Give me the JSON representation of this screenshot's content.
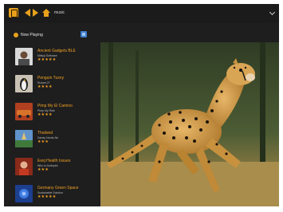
{
  "header": {
    "title": "music"
  },
  "sidebar": {
    "now_playing_label": "Now Playing",
    "tracks": [
      {
        "title": "Ancient Gadgets BLE",
        "subtitle": "Mitsuji Software",
        "stars": "★★★★★"
      },
      {
        "title": "Penguin Tuxny",
        "subtitle": "Russel-27",
        "stars": "★★★★"
      },
      {
        "title": "Pimp My El Camino",
        "subtitle": "Pimp My Ride",
        "stars": "★★★★"
      },
      {
        "title": "Thailand",
        "subtitle": "Dandy Norris-Ne",
        "stars": "★★★"
      },
      {
        "title": "Ewq Health Issues",
        "subtitle": "Who Is Ambrylot",
        "stars": "★★★"
      },
      {
        "title": "Germany Green Space",
        "subtitle": "Sustainable Solution",
        "stars": "★★★★★"
      }
    ]
  },
  "colors": {
    "accent": "#e8a11b",
    "background": "#1e1e1f",
    "badge": "#3d7cc9"
  },
  "icons": [
    "app-icon",
    "back-arrow-icon",
    "forward-arrow-icon",
    "home-icon",
    "now-playing-icon",
    "chevron-down-icon"
  ]
}
